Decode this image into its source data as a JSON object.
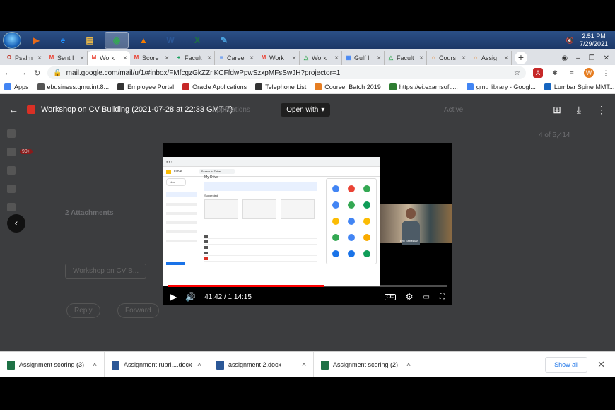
{
  "taskbar": {
    "apps": [
      {
        "name": "media-player",
        "label": "▶",
        "color": "#e66a1a"
      },
      {
        "name": "internet-explorer",
        "label": "e",
        "color": "#1e90ff"
      },
      {
        "name": "file-explorer",
        "label": "▤",
        "color": "#e8b84a"
      },
      {
        "name": "chrome",
        "label": "◉",
        "color": "#34a853"
      },
      {
        "name": "vlc",
        "label": "▲",
        "color": "#f57c00"
      },
      {
        "name": "word",
        "label": "W",
        "color": "#2b5797"
      },
      {
        "name": "excel",
        "label": "X",
        "color": "#1e7145"
      },
      {
        "name": "paint",
        "label": "✎",
        "color": "#4aa3df"
      }
    ],
    "time": "2:51 PM",
    "date": "7/29/2021"
  },
  "tabs": [
    {
      "label": "Psalm",
      "fav": "Ω",
      "color": "#c0392b"
    },
    {
      "label": "Sent I",
      "fav": "M",
      "color": "#ea4335"
    },
    {
      "label": "Work",
      "fav": "M",
      "color": "#ea4335",
      "active": true
    },
    {
      "label": "Score",
      "fav": "M",
      "color": "#ea4335"
    },
    {
      "label": "Facult",
      "fav": "+",
      "color": "#0f9d58"
    },
    {
      "label": "Caree",
      "fav": "≡",
      "color": "#4285f4"
    },
    {
      "label": "Work",
      "fav": "M",
      "color": "#ea4335"
    },
    {
      "label": "Work",
      "fav": "△",
      "color": "#34a853"
    },
    {
      "label": "Gulf I",
      "fav": "▦",
      "color": "#4285f4"
    },
    {
      "label": "Facult",
      "fav": "△",
      "color": "#34a853"
    },
    {
      "label": "Cours",
      "fav": "⌂",
      "color": "#e67e22"
    },
    {
      "label": "Assig",
      "fav": "⌂",
      "color": "#e67e22"
    }
  ],
  "address": {
    "url": "mail.google.com/mail/u/1/#inbox/FMfcgzGkZZrjKCFfdwPpwSzxpMFsSwJH?projector=1",
    "avatar": "W"
  },
  "bookmarks": [
    {
      "label": "Apps",
      "color": "#4285f4"
    },
    {
      "label": "ebusiness.gmu.int:8...",
      "color": "#555"
    },
    {
      "label": "Employee Portal",
      "color": "#333"
    },
    {
      "label": "Oracle Applications",
      "color": "#c62828"
    },
    {
      "label": "Telephone List",
      "color": "#333"
    },
    {
      "label": "Course: Batch 2019",
      "color": "#e67e22"
    },
    {
      "label": "https://ei.examsoft....",
      "color": "#2e7d32"
    },
    {
      "label": "gmu library - Googl...",
      "color": "#4285f4"
    },
    {
      "label": "Lumbar Spine MMT...",
      "color": "#1565c0"
    },
    {
      "label": "Reading list",
      "color": "#555"
    }
  ],
  "viewer": {
    "title": "Workshop on CV Building (2021-07-28 at 22:33 GMT-7)",
    "open_with": "Open with",
    "ghost_label": "Applications",
    "ghost_active": "Active",
    "ghost_count": "4 of 5,414",
    "attachments_label": "2 Attachments",
    "attachment_name": "Workshop on CV B...",
    "reply": "Reply",
    "forward": "Forward",
    "badge": "99+"
  },
  "video": {
    "time": "41:42 / 1:14:15",
    "progress": 0.5615,
    "drive_title": "Drive",
    "drive_search": "Search in Drive",
    "drive_mydrive": "My Drive",
    "drive_suggested": "Suggested",
    "drive_new": "New",
    "webcam_name": "Eric Sebastian"
  },
  "downloads": [
    {
      "label": "Assignment scoring (3)",
      "type": "xlsx",
      "color": "#1e7145"
    },
    {
      "label": "Assignment rubri....docx",
      "type": "docx",
      "color": "#2b5797"
    },
    {
      "label": "assignment 2.docx",
      "type": "docx",
      "color": "#2b5797"
    },
    {
      "label": "Assignment scoring (2)",
      "type": "xlsx",
      "color": "#1e7145"
    }
  ],
  "show_all": "Show all"
}
